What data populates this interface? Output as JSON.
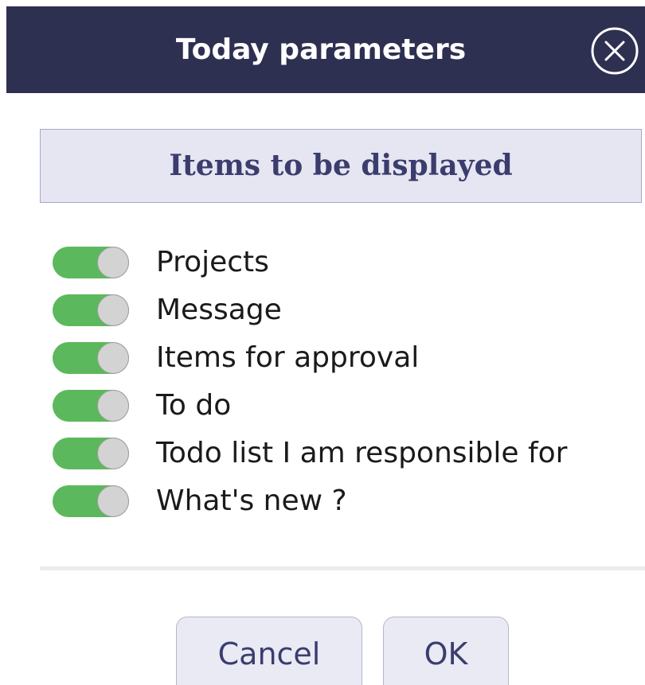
{
  "dialog": {
    "title": "Today parameters",
    "close_icon": "close-circle-icon"
  },
  "section": {
    "title": "Items to be displayed"
  },
  "items": [
    {
      "label": "Projects",
      "enabled": true
    },
    {
      "label": "Message",
      "enabled": true
    },
    {
      "label": "Items for approval",
      "enabled": true
    },
    {
      "label": "To do",
      "enabled": true
    },
    {
      "label": "Todo list I am responsible for",
      "enabled": true
    },
    {
      "label": "What's new ?",
      "enabled": true
    }
  ],
  "buttons": {
    "cancel_label": "Cancel",
    "ok_label": "OK"
  },
  "colors": {
    "titlebar": "#2e3052",
    "toggle_on": "#5cb85c",
    "section_bg": "#e6e6f3",
    "accent_text": "#3b3d6e"
  }
}
